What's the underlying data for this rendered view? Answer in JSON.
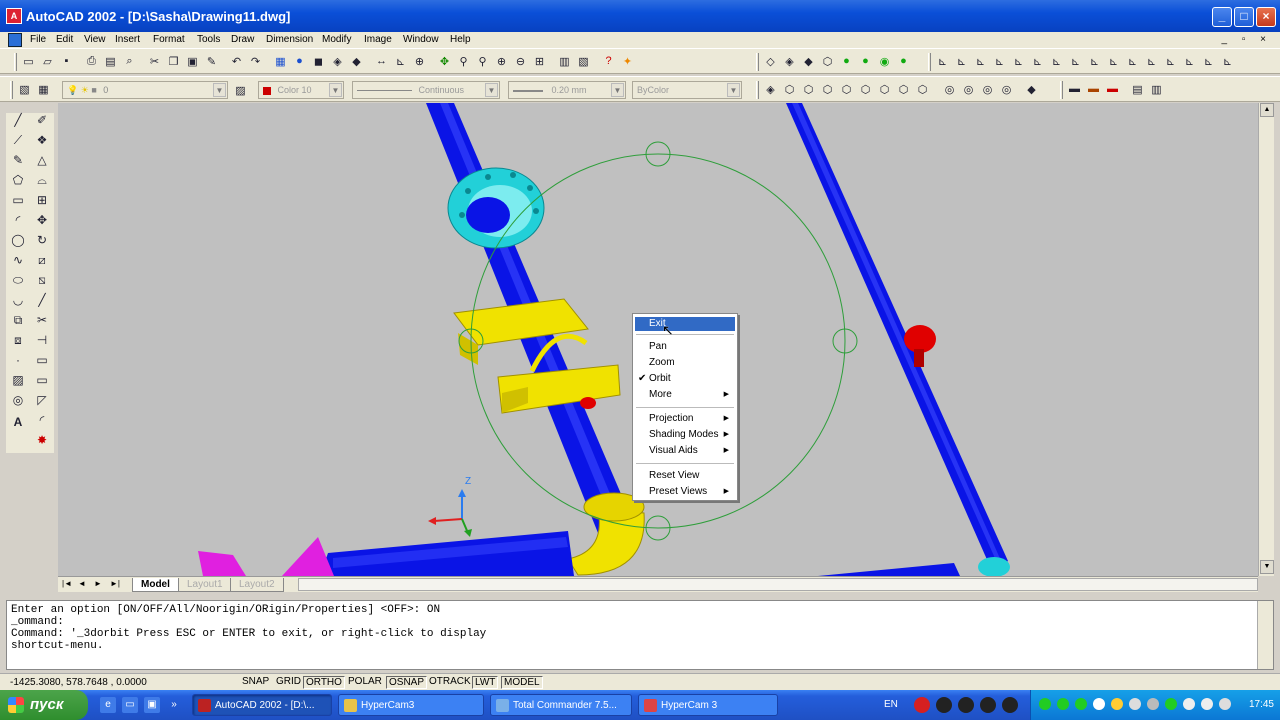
{
  "window": {
    "title": "AutoCAD 2002 - [D:\\Sasha\\Drawing11.dwg]",
    "controls": [
      "_",
      "□",
      "×"
    ]
  },
  "menus": [
    "File",
    "Edit",
    "View",
    "Insert",
    "Format",
    "Tools",
    "Draw",
    "Dimension",
    "Modify",
    "Image",
    "Window",
    "Help"
  ],
  "mdi_controls": "_ ▫ ×",
  "properties": {
    "layer": "0",
    "color": "Color 10",
    "linetype": "Continuous",
    "lineweight": "0.20 mm",
    "plotstyle": "ByColor"
  },
  "tabs": {
    "model": "Model",
    "layout1": "Layout1",
    "layout2": "Layout2",
    "nav": [
      "|◄",
      "◄",
      "►",
      "►|"
    ]
  },
  "context_menu": {
    "items": [
      {
        "label": "Exit",
        "highlighted": true
      },
      {
        "label": "Pan"
      },
      {
        "label": "Zoom"
      },
      {
        "label": "Orbit",
        "checked": true
      },
      {
        "label": "More",
        "submenu": true
      },
      {
        "label": "Projection",
        "submenu": true
      },
      {
        "label": "Shading Modes",
        "submenu": true
      },
      {
        "label": "Visual Aids",
        "submenu": true
      },
      {
        "label": "Reset View"
      },
      {
        "label": "Preset Views",
        "submenu": true
      }
    ]
  },
  "ucs": {
    "z_label": "Z"
  },
  "command_window": {
    "lines": [
      "Enter an option [ON/OFF/All/Noorigin/ORigin/Properties] <OFF>: ON",
      "_ommand:",
      "Command: '_3dorbit Press ESC or ENTER to exit, or right-click to display",
      "shortcut-menu."
    ]
  },
  "status_bar": {
    "coords": "-1425.3080, 578.7648 , 0.0000",
    "toggles": [
      "SNAP",
      "GRID",
      "ORTHO",
      "POLAR",
      "OSNAP",
      "OTRACK",
      "LWT",
      "MODEL"
    ]
  },
  "taskbar": {
    "start_label": "пуск",
    "tasks": [
      {
        "label": "AutoCAD 2002 - [D:\\...",
        "active": true
      },
      {
        "label": "HyperCam3"
      },
      {
        "label": "Total Commander 7.5..."
      },
      {
        "label": "HyperCam 3"
      }
    ],
    "language": "EN",
    "clock": "17:45"
  },
  "colors": {
    "pipe": "#0a14e6",
    "flange": "#22d0d8",
    "support": "#f0e200",
    "orbit": "#2e9e3a",
    "canvas": "#c0c0c0",
    "valve": "#e00000",
    "magenta": "#e020e0"
  },
  "icons": {
    "draw_toolbar": [
      "line-icon",
      "construction-line-icon",
      "polyline-icon",
      "polygon-icon",
      "rectangle-icon",
      "arc-icon",
      "circle-icon",
      "spline-icon",
      "ellipse-icon",
      "insert-block-icon",
      "make-block-icon",
      "point-icon",
      "hatch-icon",
      "region-icon",
      "mtext-icon"
    ],
    "modify_toolbar": [
      "erase-icon",
      "copy-icon",
      "mirror-icon",
      "offset-icon",
      "array-icon",
      "move-icon",
      "rotate-icon",
      "scale-icon",
      "stretch-icon",
      "lengthen-icon",
      "trim-icon",
      "extend-icon",
      "break-icon",
      "chamfer-icon",
      "fillet-icon",
      "explode-icon"
    ]
  }
}
